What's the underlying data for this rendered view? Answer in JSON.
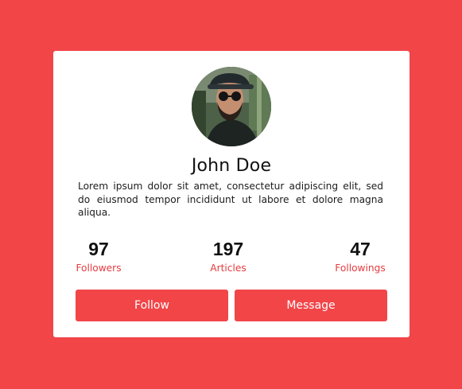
{
  "colors": {
    "background": "#f24548",
    "card": "#ffffff",
    "accent": "#f24548",
    "label": "#e53b3f"
  },
  "profile": {
    "avatar_icon": "profile-photo",
    "name": "John Doe",
    "bio": "Lorem ipsum dolor sit amet, consectetur adipiscing elit, sed do eiusmod tempor incididunt ut labore et dolore magna aliqua."
  },
  "stats": [
    {
      "value": "97",
      "label": "Followers"
    },
    {
      "value": "197",
      "label": "Articles"
    },
    {
      "value": "47",
      "label": "Followings"
    }
  ],
  "actions": {
    "follow_label": "Follow",
    "message_label": "Message"
  }
}
